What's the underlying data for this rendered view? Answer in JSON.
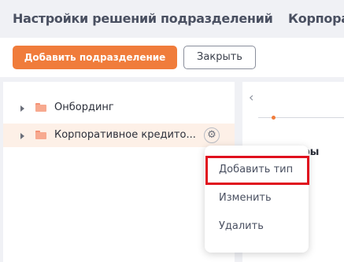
{
  "header": {
    "title": "Настройки решений подразделений",
    "title_right": "Корпора"
  },
  "toolbar": {
    "add_label": "Добавить подразделение",
    "close_label": "Закрыть"
  },
  "tree": {
    "items": [
      {
        "label": "Онбординг",
        "icon": "folder-icon"
      },
      {
        "label": "Корпоративное кредито...",
        "icon": "folder-icon",
        "selected": true
      }
    ]
  },
  "right_panel": {
    "partial_text": "етры"
  },
  "context_menu": {
    "items": [
      {
        "label": "Добавить тип",
        "highlighted": true
      },
      {
        "label": "Изменить"
      },
      {
        "label": "Удалить"
      }
    ]
  },
  "colors": {
    "accent": "#f07c3b",
    "highlight_border": "#e0101e",
    "selected_row": "#fdf0e7"
  }
}
